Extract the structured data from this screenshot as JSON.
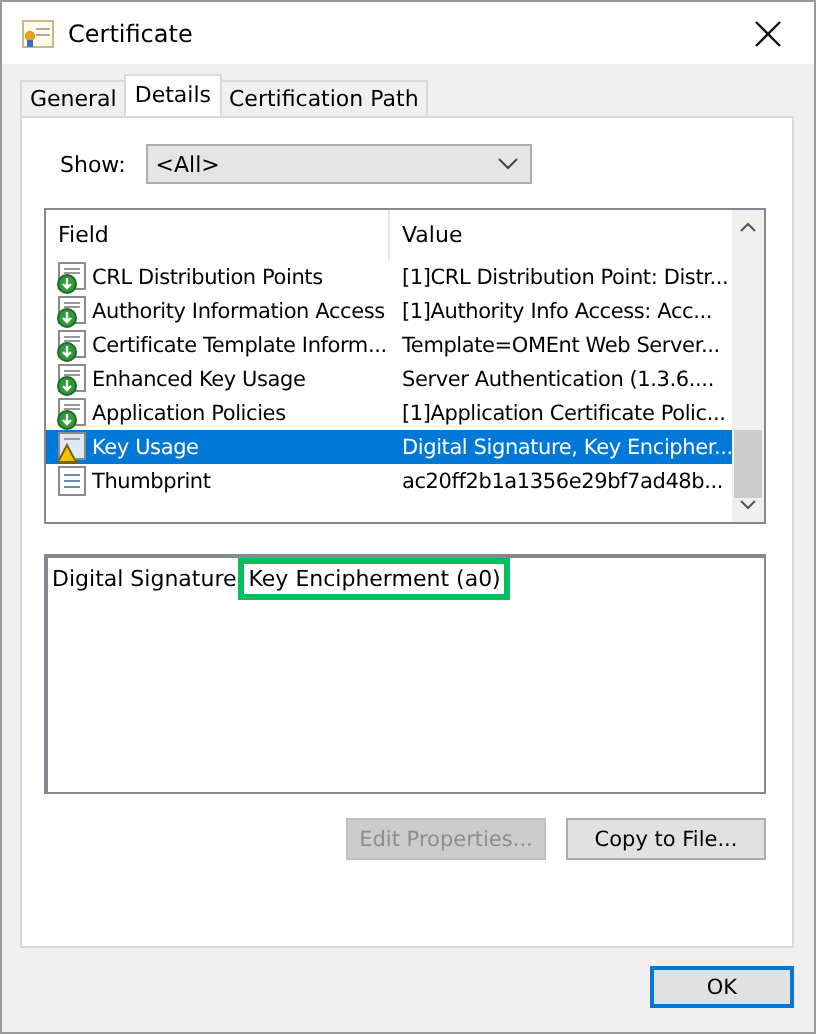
{
  "window": {
    "title": "Certificate"
  },
  "tabs": [
    {
      "label": "General",
      "selected": false
    },
    {
      "label": "Details",
      "selected": true
    },
    {
      "label": "Certification Path",
      "selected": false
    }
  ],
  "show": {
    "label": "Show:",
    "value": "<All>"
  },
  "table": {
    "columns": [
      "Field",
      "Value"
    ],
    "rows": [
      {
        "kind": "extension",
        "field": "CRL Distribution Points",
        "value": "[1]CRL Distribution Point: Distr...",
        "selected": false
      },
      {
        "kind": "extension",
        "field": "Authority Information Access",
        "value": "[1]Authority Info Access: Acc...",
        "selected": false
      },
      {
        "kind": "extension",
        "field": "Certificate Template Inform...",
        "value": "Template=OMEnt Web Server...",
        "selected": false
      },
      {
        "kind": "extension",
        "field": "Enhanced Key Usage",
        "value": "Server Authentication (1.3.6....",
        "selected": false
      },
      {
        "kind": "extension",
        "field": "Application Policies",
        "value": "[1]Application Certificate Polic...",
        "selected": false
      },
      {
        "kind": "warning",
        "field": "Key Usage",
        "value": "Digital Signature, Key Encipher...",
        "selected": true
      },
      {
        "kind": "property",
        "field": "Thumbprint",
        "value": "ac20ff2b1a1356e29bf7ad48b...",
        "selected": false
      }
    ]
  },
  "detail": [
    {
      "text": "Digital Signature",
      "highlighted": false
    },
    {
      "text": "Key Encipherment (a0)",
      "highlighted": true
    }
  ],
  "buttons": [
    {
      "label": "Edit Properties...",
      "disabled": true
    },
    {
      "label": "Copy to File...",
      "disabled": false
    }
  ],
  "footer_button": {
    "label": "OK",
    "default": true
  }
}
